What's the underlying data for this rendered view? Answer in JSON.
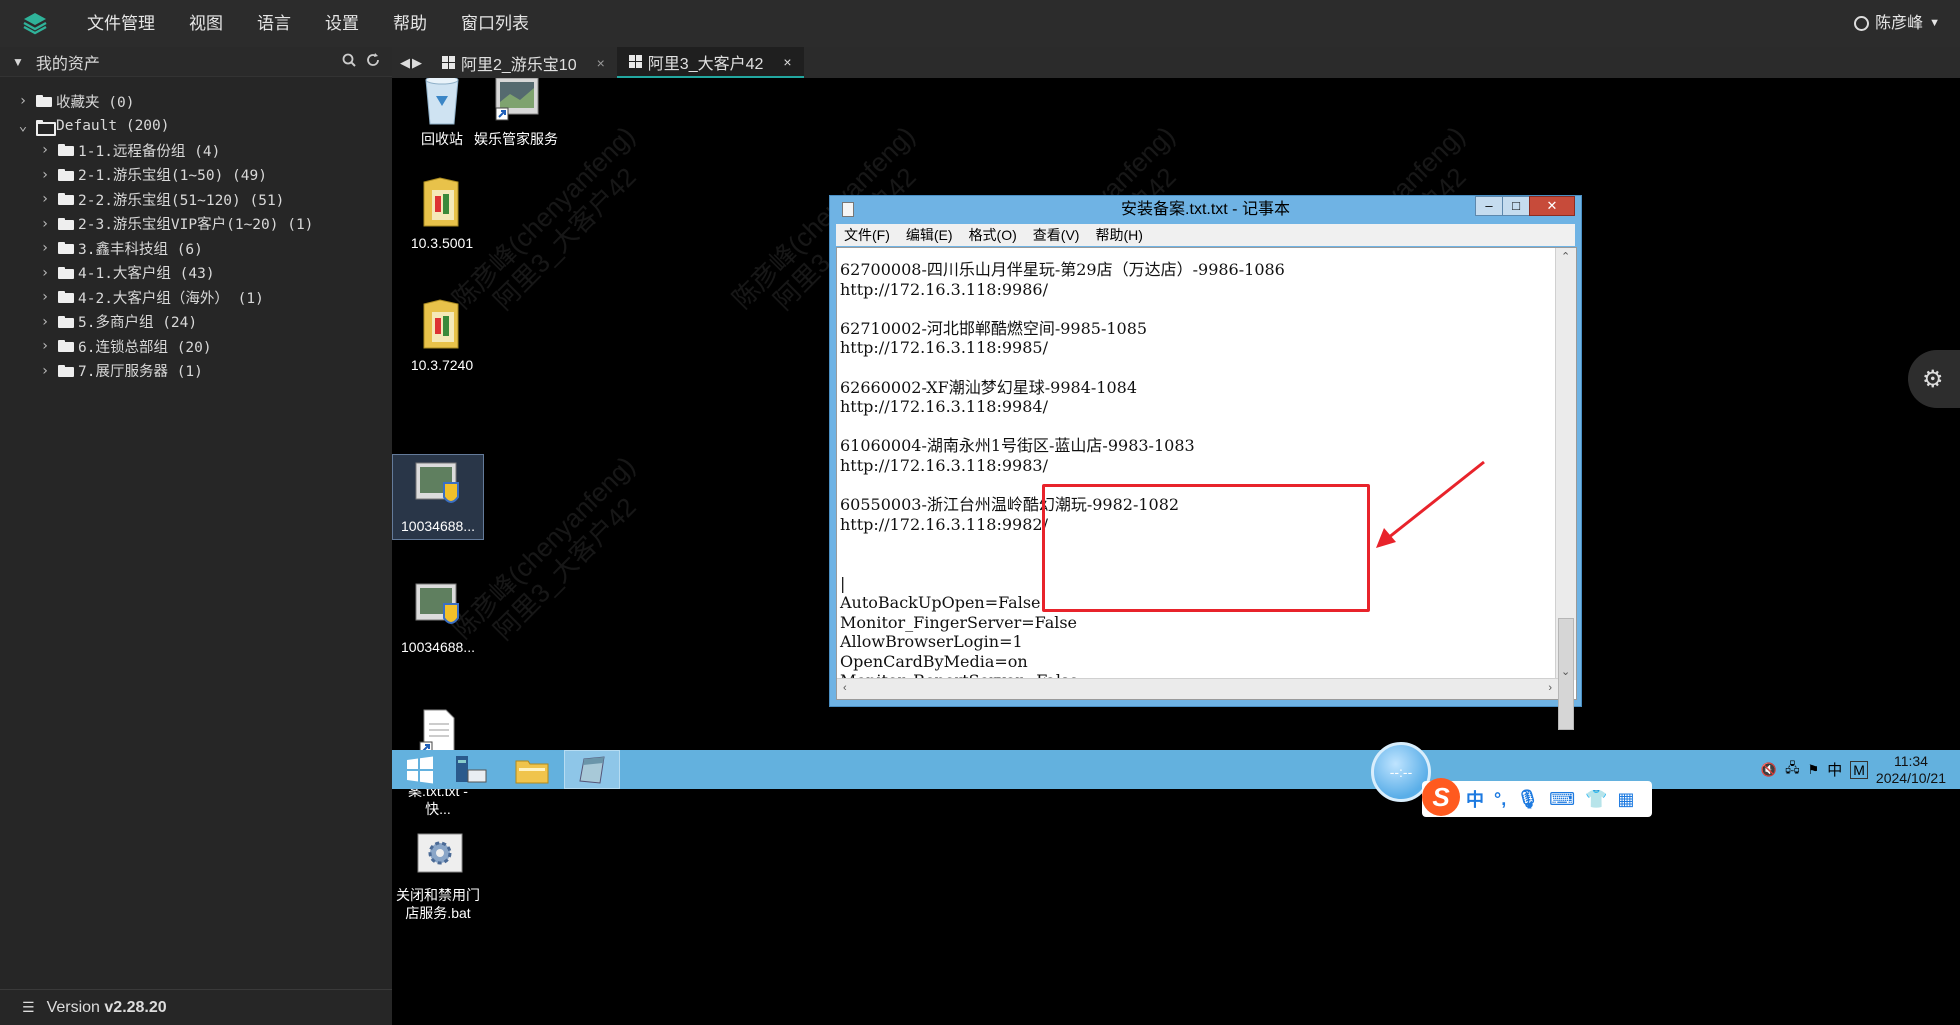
{
  "menubar": {
    "items": [
      "文件管理",
      "视图",
      "语言",
      "设置",
      "帮助",
      "窗口列表"
    ],
    "user": "陈彦峰"
  },
  "sidebar": {
    "title": "我的资产",
    "tree": [
      {
        "label": "收藏夹 (0)",
        "level": 0,
        "open": false
      },
      {
        "label": "Default (200)",
        "level": 0,
        "open": true
      },
      {
        "label": "1-1.远程备份组 (4)",
        "level": 1,
        "open": false
      },
      {
        "label": "2-1.游乐宝组(1~50) (49)",
        "level": 1,
        "open": false
      },
      {
        "label": "2-2.游乐宝组(51~120) (51)",
        "level": 1,
        "open": false
      },
      {
        "label": "2-3.游乐宝组VIP客户(1~20) (1)",
        "level": 1,
        "open": false
      },
      {
        "label": "3.鑫丰科技组 (6)",
        "level": 1,
        "open": false
      },
      {
        "label": "4-1.大客户组 (43)",
        "level": 1,
        "open": false
      },
      {
        "label": "4-2.大客户组（海外） (1)",
        "level": 1,
        "open": false
      },
      {
        "label": "5.多商户组 (24)",
        "level": 1,
        "open": false
      },
      {
        "label": "6.连锁总部组 (20)",
        "level": 1,
        "open": false
      },
      {
        "label": "7.展厅服务器 (1)",
        "level": 1,
        "open": false
      }
    ],
    "version_label": "Version",
    "version": "v2.28.20"
  },
  "tabs": [
    {
      "label": "阿里2_游乐宝10",
      "active": false
    },
    {
      "label": "阿里3_大客户42",
      "active": true
    }
  ],
  "desktop": {
    "icons": [
      {
        "label": "回收站"
      },
      {
        "label": "娱乐管家服务"
      },
      {
        "label": "10.3.5001"
      },
      {
        "label": "10.3.7240"
      },
      {
        "label": "10034688..."
      },
      {
        "label": "10034688..."
      },
      {
        "label": "安装备案.txt.txt - 快..."
      },
      {
        "label": "关闭和禁用门店服务.bat"
      }
    ],
    "watermark_line1": "陈彦峰(chenyanfeng)",
    "watermark_line2": "阿里3_大客户42"
  },
  "notepad": {
    "title": "安装备案.txt.txt - 记事本",
    "menu": [
      "文件(F)",
      "编辑(E)",
      "格式(O)",
      "查看(V)",
      "帮助(H)"
    ],
    "content": "62700008-四川乐山月伴星玩-第29店（万达店）-9986-1086\nhttp://172.16.3.118:9986/\n\n62710002-河北邯郸酷燃空间-9985-1085\nhttp://172.16.3.118:9985/\n\n62660002-XF潮汕梦幻星球-9984-1084\nhttp://172.16.3.118:9984/\n\n61060004-湖南永州1号街区-蓝山店-9983-1083\nhttp://172.16.3.118:9983/\n\n60550003-浙江台州温岭酷幻潮玩-9982-1082\nhttp://172.16.3.118:9982/\n\n\n|\nAutoBackUpOpen=False\nMonitor_FingerServer=False\nAllowBrowserLogin=1\nOpenCardByMedia=on\nMonitor_ReportServer=False"
  },
  "taskbar": {
    "time": "11:34",
    "date": "2024/10/21",
    "ime_label": "中",
    "tray_lang": "中",
    "tray_m": "M",
    "ball_text": "--:--"
  },
  "colors": {
    "accent": "#22a7a0",
    "highlight": "#e8232b",
    "taskbar": "#63b1de"
  }
}
